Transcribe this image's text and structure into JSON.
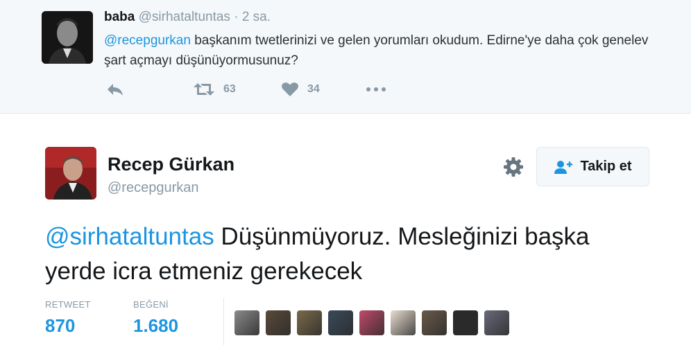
{
  "reply": {
    "name": "baba",
    "handle": "@sirhataltuntas",
    "separator": "·",
    "time": "2 sa.",
    "mention": "@recepgurkan",
    "text": " başkanım twetlerinizi ve gelen yorumları okudum. Edirne'ye daha çok genelev şart açmayı düşünüyormusunuz?",
    "retweet_count": "63",
    "like_count": "34"
  },
  "tweet": {
    "name": "Recep Gürkan",
    "handle": "@recepgurkan",
    "follow_label": "Takip et",
    "mention": "@sirhataltuntas",
    "text": " Düşünmüyoruz. Mesleğinizi başka yerde icra etmeniz gerekecek",
    "stats": {
      "retweet_label": "RETWEET",
      "retweet_value": "870",
      "like_label": "BEĞENİ",
      "like_value": "1.680"
    },
    "liker_colors": [
      "#8a8a8a",
      "#5a4a3a",
      "#7a6a4a",
      "#3a4a5a",
      "#c04a6a",
      "#e8ddd0",
      "#6a5a4a",
      "#2a2a2a",
      "#6a6a7a"
    ]
  },
  "icons": [
    "reply-icon",
    "retweet-icon",
    "heart-icon",
    "more-icon",
    "gear-icon",
    "follow-user-icon"
  ],
  "colors": {
    "accent": "#1b95e0",
    "muted": "#8899a6",
    "reply_background": "#f5f8fa"
  }
}
